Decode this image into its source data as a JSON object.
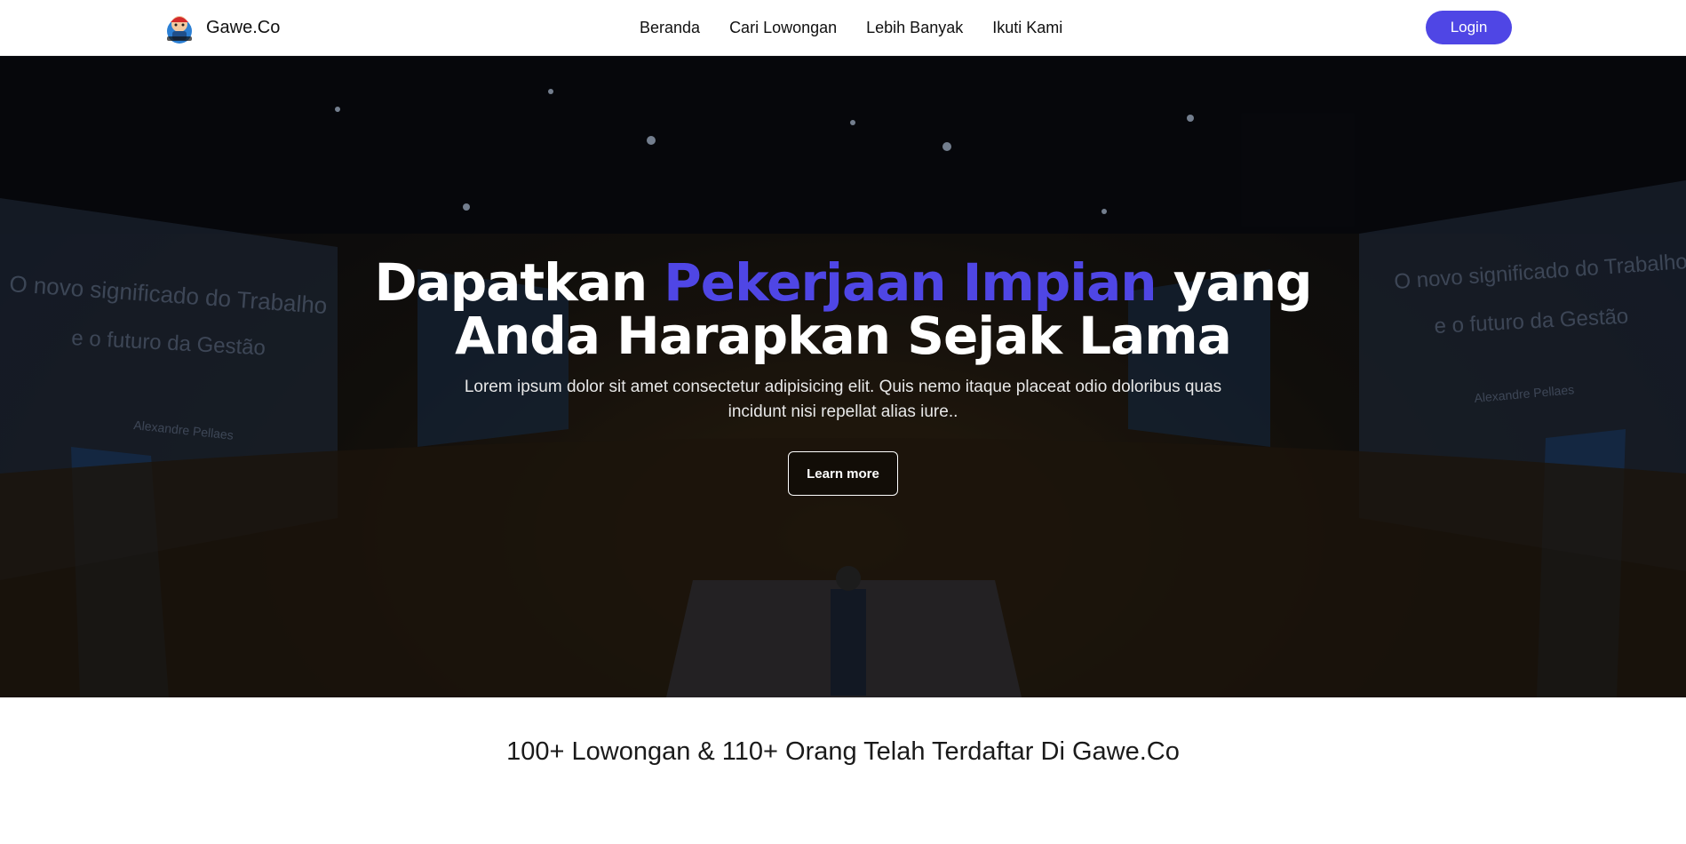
{
  "navbar": {
    "brand_name": "Gawe.Co",
    "logo_icon": "mascot-logo-icon",
    "menu": [
      {
        "label": "Beranda"
      },
      {
        "label": "Cari Lowongan"
      },
      {
        "label": "Lebih Banyak"
      },
      {
        "label": "Ikuti Kami"
      }
    ],
    "login_label": "Login"
  },
  "hero": {
    "title_part1": "Dapatkan ",
    "title_accent": "Pekerjaan Impian",
    "title_part2": " yang Anda Harapkan Sejak Lama",
    "subtitle": "Lorem ipsum dolor sit amet consectetur adipisicing elit. Quis nemo itaque placeat odio doloribus quas incidunt nisi repellat alias iure..",
    "cta_label": "Learn more",
    "background": {
      "screen_left_line1": "O novo significado do Trabalho",
      "screen_left_line2": "e o futuro da Gestão",
      "screen_left_name": "Alexandre Pellaes",
      "screen_right_line1": "O novo significado do Trabalho",
      "screen_right_line2": "e o futuro da Gestão",
      "screen_right_name": "Alexandre Pellaes"
    }
  },
  "stats": {
    "text": "100+ Lowongan & 110+ Orang Telah Terdaftar Di Gawe.Co"
  },
  "colors": {
    "accent": "#4f46e5",
    "navbar_bg": "#ffffff",
    "hero_text": "#ffffff"
  }
}
